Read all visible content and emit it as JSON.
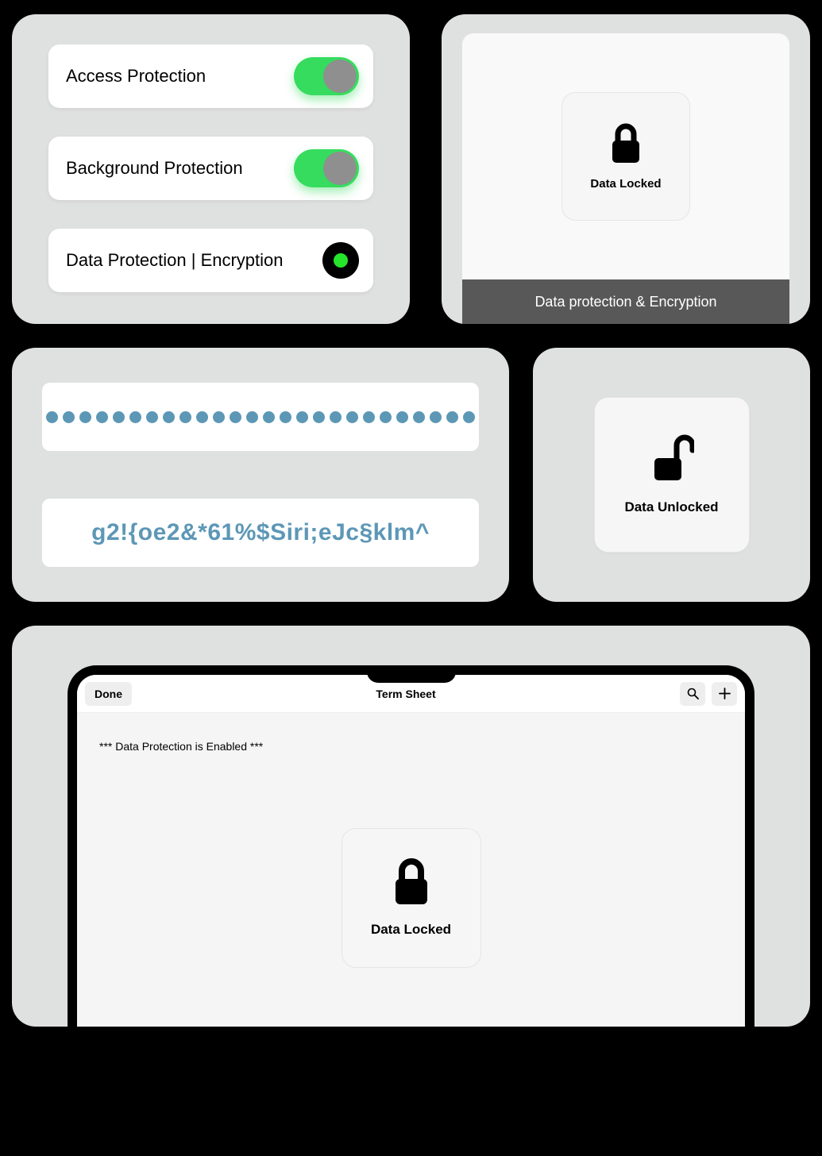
{
  "panel1": {
    "row1_label": "Access Protection",
    "row2_label": "Background Protection",
    "row3_label": "Data Protection | Encryption"
  },
  "panel2": {
    "lock_label": "Data Locked",
    "caption": "Data protection & Encryption"
  },
  "panel3": {
    "masked_dots": 26,
    "revealed": "g2!{oe2&*61%$Siri;eJc§klm^"
  },
  "panel4": {
    "label": "Data Unlocked"
  },
  "panel5": {
    "done_label": "Done",
    "title": "Term Sheet",
    "note": "*** Data Protection is Enabled ***",
    "lock_label": "Data Locked"
  },
  "colors": {
    "toggle_on": "#35dc5d",
    "accent_blue": "#5d97b6"
  }
}
